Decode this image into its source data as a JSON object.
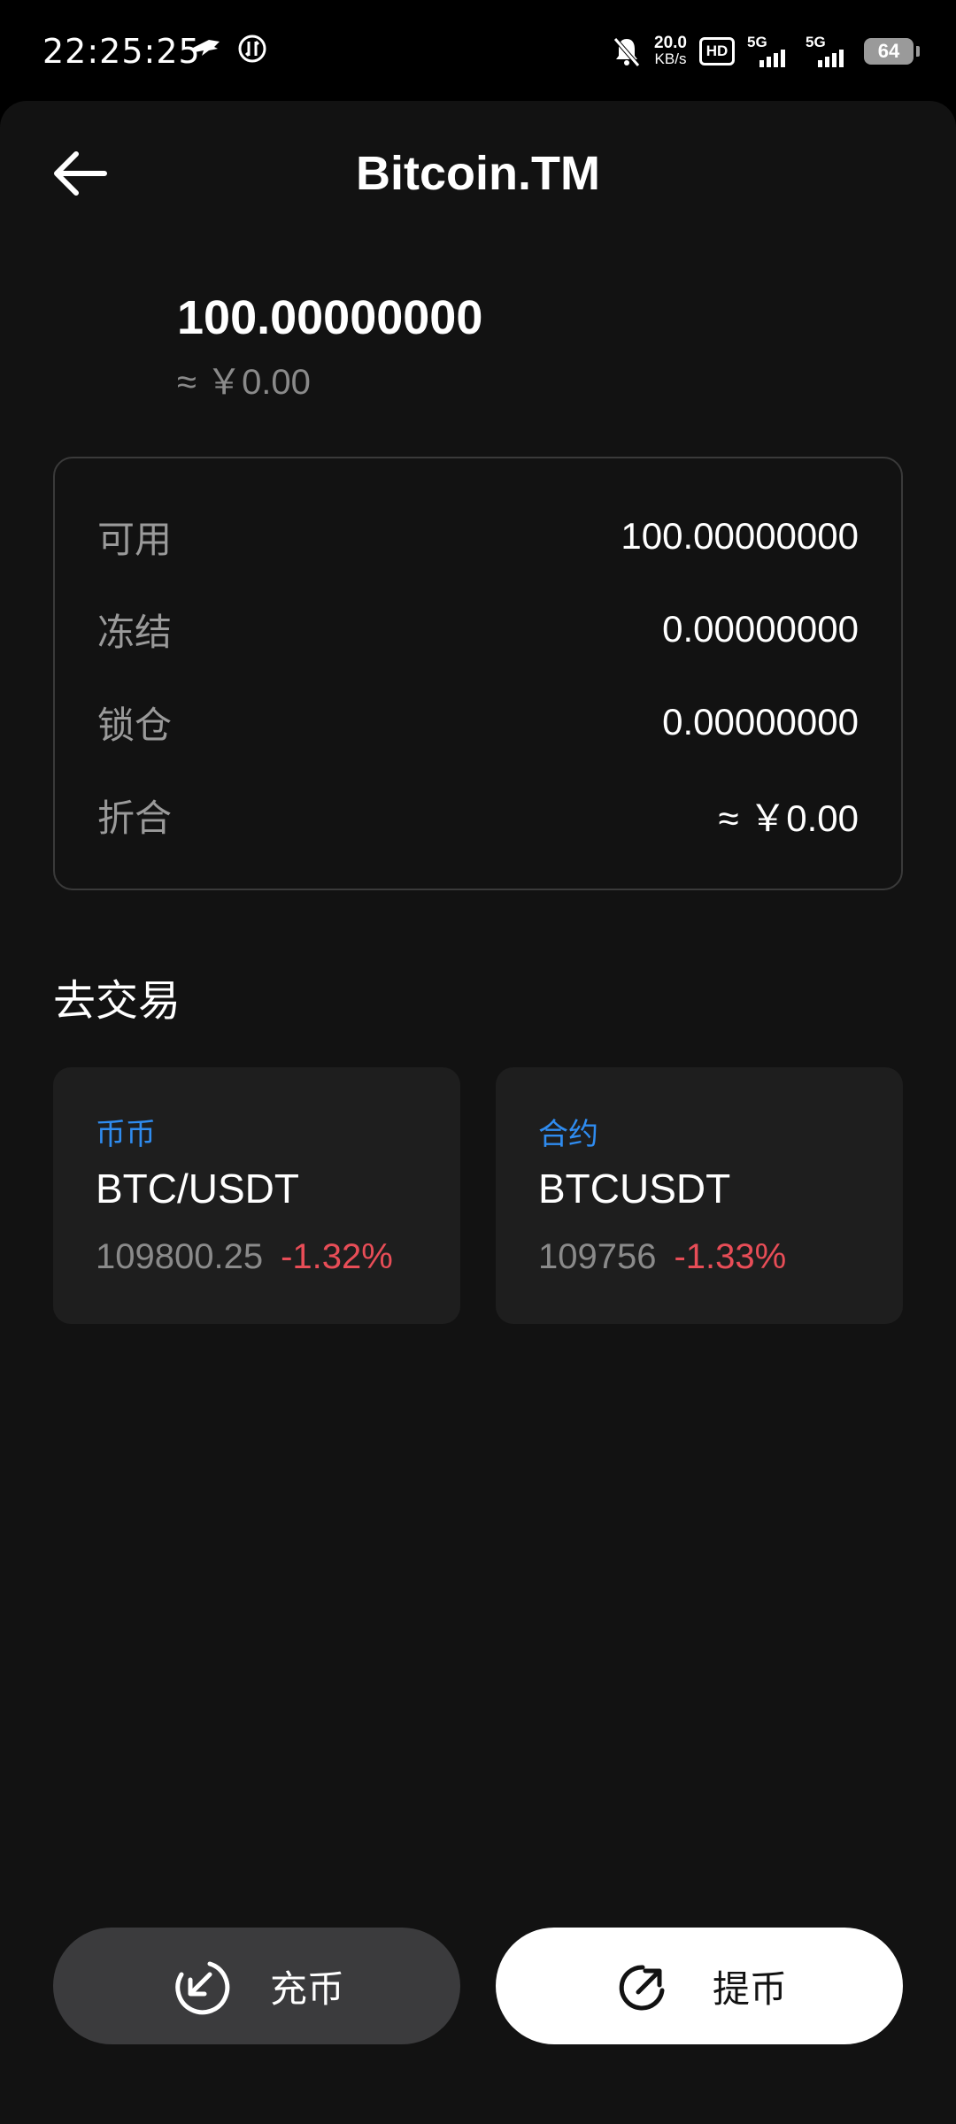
{
  "status_bar": {
    "time": "22:25:25",
    "net_speed_value": "20.0",
    "net_speed_unit": "KB/s",
    "hd_label": "HD",
    "signal1_label": "5G",
    "signal2_label": "5G",
    "battery_level": "64"
  },
  "header": {
    "title": "Bitcoin.TM"
  },
  "balance": {
    "amount": "100.00000000",
    "approx_value": "≈ ￥0.00"
  },
  "details": [
    {
      "label": "可用",
      "value": "100.00000000"
    },
    {
      "label": "冻结",
      "value": "0.00000000"
    },
    {
      "label": "锁仓",
      "value": "0.00000000"
    },
    {
      "label": "折合",
      "value": "≈ ￥0.00"
    }
  ],
  "trade_section": {
    "title": "去交易",
    "cards": [
      {
        "type": "币币",
        "pair": "BTC/USDT",
        "price": "109800.25",
        "change": "-1.32%"
      },
      {
        "type": "合约",
        "pair": "BTCUSDT",
        "price": "109756",
        "change": "-1.33%"
      }
    ]
  },
  "actions": {
    "deposit_label": "充币",
    "withdraw_label": "提币"
  },
  "colors": {
    "background": "#121212",
    "accent_blue": "#2f8cf0",
    "negative_red": "#e84d57",
    "muted_text": "#8a8a8a"
  }
}
